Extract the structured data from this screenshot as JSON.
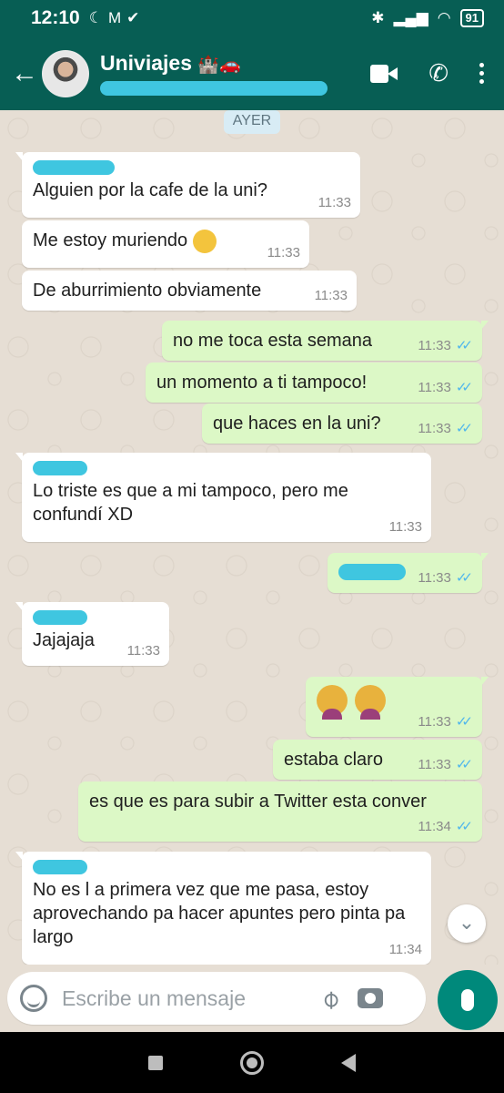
{
  "status_bar": {
    "time": "12:10",
    "battery": "91",
    "left_icons": [
      "moon-icon",
      "gmail-icon",
      "check-icon"
    ],
    "right_icons": [
      "bluetooth-icon",
      "signal-icon",
      "wifi-icon",
      "battery-icon"
    ]
  },
  "header": {
    "title": "Univiajes",
    "title_emoji": "🏰🚗",
    "actions": [
      "video-call-icon",
      "phone-icon",
      "more-icon"
    ]
  },
  "day_divider": "AYER",
  "messages": [
    {
      "direction": "in",
      "text": "Alguien por la cafe de la uni?",
      "time": "11:33"
    },
    {
      "direction": "in",
      "text": "Me estoy muriendo",
      "time": "11:33"
    },
    {
      "direction": "in",
      "text": "De aburrimiento obviamente",
      "time": "11:33"
    },
    {
      "direction": "out",
      "text": "no me toca esta semana",
      "time": "11:33"
    },
    {
      "direction": "out",
      "text": "un momento a ti tampoco!",
      "time": "11:33"
    },
    {
      "direction": "out",
      "text": "que haces en la uni?",
      "time": "11:33"
    },
    {
      "direction": "in",
      "text": "Lo triste es que a mi tampoco, pero me confundí XD",
      "time": "11:33"
    },
    {
      "direction": "out",
      "text": "",
      "time": "11:33"
    },
    {
      "direction": "in",
      "text": "Jajajaja",
      "time": "11:33"
    },
    {
      "direction": "out",
      "text": "",
      "time": "11:33"
    },
    {
      "direction": "out",
      "text": "estaba claro",
      "time": "11:33"
    },
    {
      "direction": "out",
      "text": "es que es para subir a Twitter esta conver",
      "time": "11:34"
    },
    {
      "direction": "in",
      "text": "No es l a primera vez que me pasa, estoy aprovechando pa hacer apuntes pero pinta pa largo",
      "time": "11:34"
    }
  ],
  "input": {
    "placeholder": "Escribe un mensaje"
  },
  "colors": {
    "header": "#075e54",
    "outgoing": "#dcf8c6",
    "incoming": "#ffffff",
    "chat_bg": "#e6ded4",
    "fab": "#00897b",
    "ticks": "#4fb6ec"
  }
}
